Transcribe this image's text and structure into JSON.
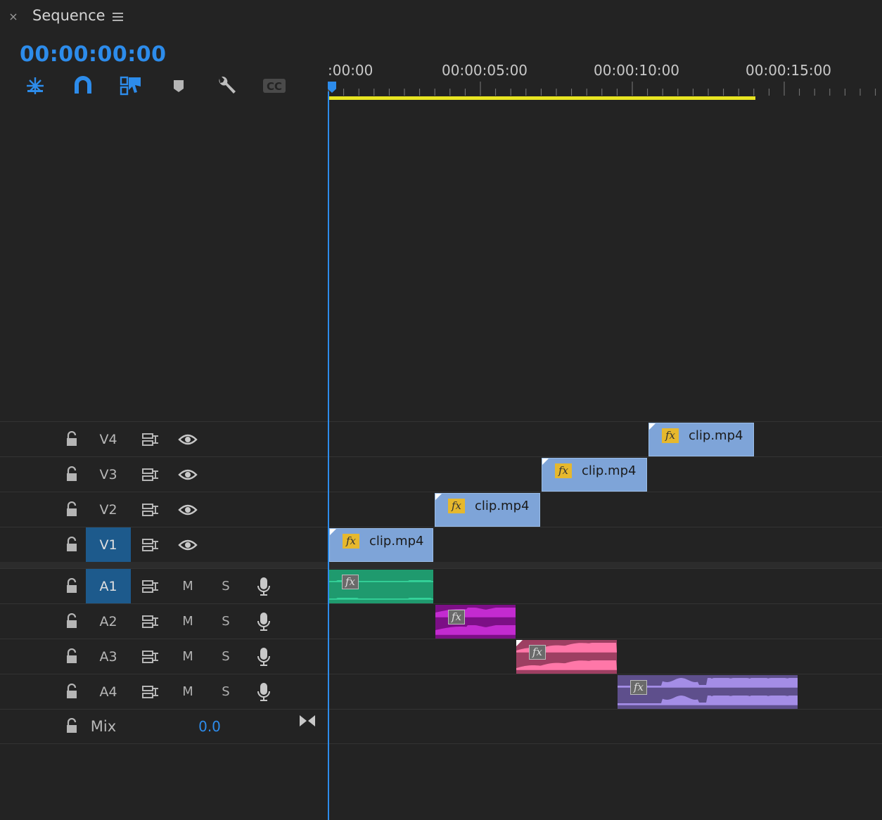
{
  "panel": {
    "close": "×",
    "title": "Sequence",
    "menu_icon": "hamburger-menu-icon"
  },
  "timecode": "00:00:00:00",
  "toolbar": [
    {
      "name": "insert-nest-icon"
    },
    {
      "name": "snap-magnet-icon"
    },
    {
      "name": "linked-selection-icon"
    },
    {
      "name": "add-marker-icon"
    },
    {
      "name": "wrench-settings-icon"
    },
    {
      "name": "captions-icon",
      "label": "CC"
    }
  ],
  "ruler": {
    "labels": [
      ":00:00",
      "00:00:05:00",
      "00:00:10:00",
      "00:00:15:00"
    ]
  },
  "video_tracks": [
    {
      "label": "V4",
      "targeted": false
    },
    {
      "label": "V3",
      "targeted": false
    },
    {
      "label": "V2",
      "targeted": false
    },
    {
      "label": "V1",
      "targeted": true
    }
  ],
  "audio_tracks": [
    {
      "label": "A1",
      "targeted": true,
      "mute": "M",
      "solo": "S"
    },
    {
      "label": "A2",
      "targeted": false,
      "mute": "M",
      "solo": "S"
    },
    {
      "label": "A3",
      "targeted": false,
      "mute": "M",
      "solo": "S"
    },
    {
      "label": "A4",
      "targeted": false,
      "mute": "M",
      "solo": "S"
    }
  ],
  "mix": {
    "label": "Mix",
    "value": "0.0"
  },
  "video_clips": [
    {
      "track": "V4",
      "name": "clip.mp4",
      "fx": "fx"
    },
    {
      "track": "V3",
      "name": "clip.mp4",
      "fx": "fx"
    },
    {
      "track": "V2",
      "name": "clip.mp4",
      "fx": "fx"
    },
    {
      "track": "V1",
      "name": "clip.mp4",
      "fx": "fx"
    }
  ],
  "audio_clips": [
    {
      "track": "A1",
      "fx": "fx",
      "color": "#1f9a6e",
      "wave": "#35d39a"
    },
    {
      "track": "A2",
      "fx": "fx",
      "color": "#7c0f86",
      "wave": "#c32bd0"
    },
    {
      "track": "A3",
      "fx": "fx",
      "color": "#9e3f62",
      "wave": "#ff77a8"
    },
    {
      "track": "A4",
      "fx": "fx",
      "color": "#5e4f8c",
      "wave": "#a48de6"
    }
  ],
  "colors": {
    "accent": "#2d8ceb",
    "work_area": "#e8e522",
    "video_clip": "#7ea4d8",
    "fx_badge": "#e6b82d"
  }
}
